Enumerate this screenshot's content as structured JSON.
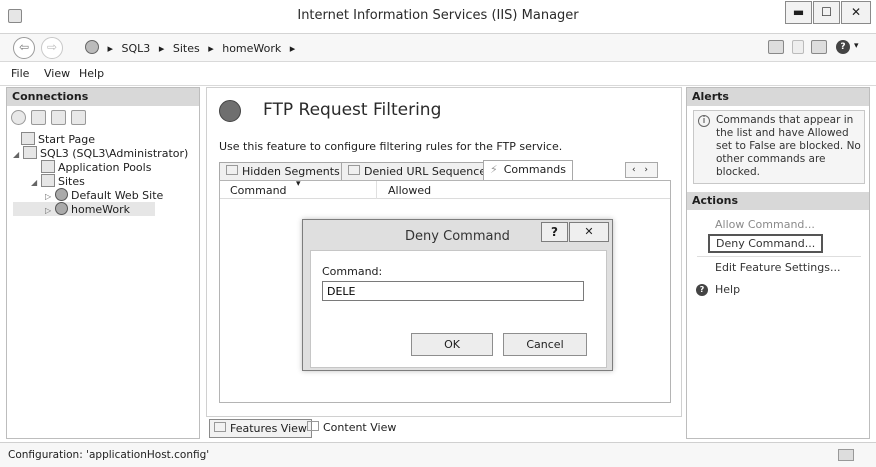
{
  "window": {
    "title": "Internet Information Services (IIS) Manager",
    "minimize": "▬",
    "maximize": "☐",
    "close": "✕"
  },
  "addressbar": {
    "back": "⇦",
    "forward": "⇨",
    "crumbs": [
      "SQL3",
      "Sites",
      "homeWork"
    ],
    "separator": "▸",
    "help_dropdown": "▾"
  },
  "menu": {
    "file": "File",
    "view": "View",
    "help": "Help"
  },
  "connections": {
    "header": "Connections",
    "tree": {
      "start_page": "Start Page",
      "server": "SQL3 (SQL3\\Administrator)",
      "app_pools": "Application Pools",
      "sites": "Sites",
      "default_site": "Default Web Site",
      "homework": "homeWork"
    }
  },
  "main": {
    "title": "FTP Request Filtering",
    "description": "Use this feature to configure filtering rules for the FTP service.",
    "tabs": [
      "Hidden Segments",
      "Denied URL Sequences",
      "Commands"
    ],
    "tab_scroll": "‹ ›",
    "columns": {
      "command": "Command",
      "allowed": "Allowed"
    },
    "sort_indicator": "▾"
  },
  "viewbar": {
    "features_view": "Features View",
    "content_view": "Content View"
  },
  "alerts": {
    "header": "Alerts",
    "icon": "i",
    "text": "Commands that appear in the list and have Allowed set to False are blocked. No other commands are blocked."
  },
  "actions": {
    "header": "Actions",
    "allow": "Allow Command...",
    "deny": "Deny Command...",
    "edit": "Edit Feature Settings...",
    "help": "Help",
    "help_icon": "?"
  },
  "status": {
    "text": "Configuration: 'applicationHost.config'"
  },
  "dialog": {
    "title": "Deny Command",
    "help_btn": "?",
    "close_btn": "✕",
    "command_label": "Command:",
    "command_value": "DELE",
    "ok": "OK",
    "cancel": "Cancel"
  }
}
